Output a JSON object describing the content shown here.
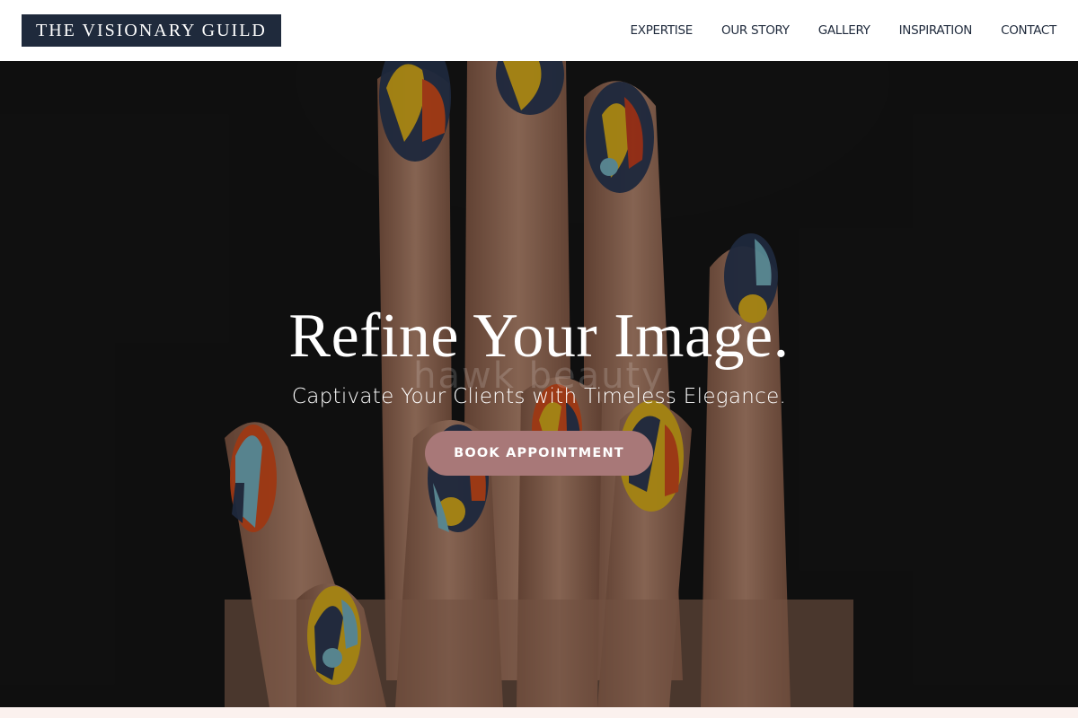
{
  "header": {
    "logo": "THE VISIONARY GUILD",
    "nav": [
      {
        "label": "EXPERTISE"
      },
      {
        "label": "OUR STORY"
      },
      {
        "label": "GALLERY"
      },
      {
        "label": "INSPIRATION"
      },
      {
        "label": "CONTACT"
      }
    ]
  },
  "hero": {
    "image": "hand with colorful abstract nail art",
    "watermark": "hawk beauty",
    "title": "Refine Your Image.",
    "subtitle": "Captivate Your Clients with Timeless Elegance.",
    "cta_label": "BOOK APPOINTMENT"
  },
  "colors": {
    "header_bg": "#ffffff",
    "logo_bg": "#1f2a3c",
    "nav_text": "#1f2a3c",
    "cta_bg": "#a87878",
    "page_bg": "#fbf1ee"
  }
}
